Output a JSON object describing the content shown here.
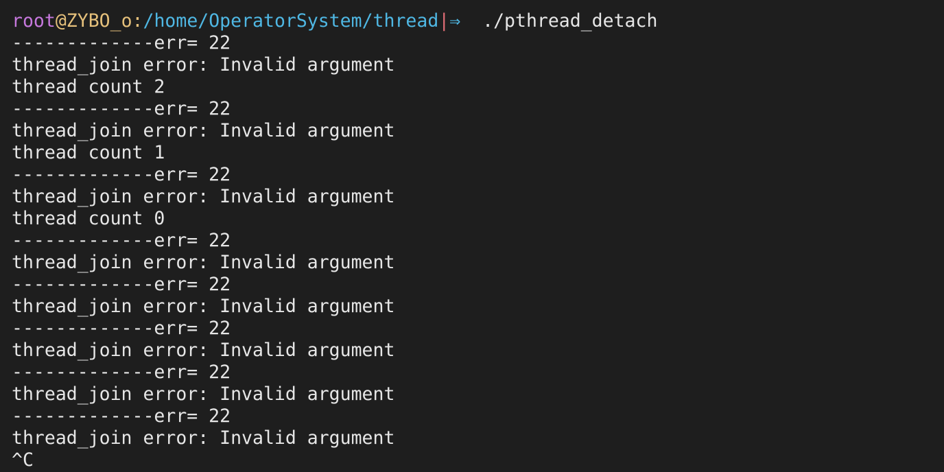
{
  "prompt": {
    "user": "root",
    "at": "@",
    "host": "ZYBO_o",
    "colon": ":",
    "path": "/home/OperatorSystem/thread",
    "separator": "|",
    "arrow": "⇒",
    "command": "  ./pthread_detach"
  },
  "output": [
    "-------------err= 22",
    "thread_join error: Invalid argument",
    "thread count 2",
    "-------------err= 22",
    "thread_join error: Invalid argument",
    "thread count 1",
    "-------------err= 22",
    "thread_join error: Invalid argument",
    "thread count 0",
    "-------------err= 22",
    "thread_join error: Invalid argument",
    "-------------err= 22",
    "thread_join error: Invalid argument",
    "-------------err= 22",
    "thread_join error: Invalid argument",
    "-------------err= 22",
    "thread_join error: Invalid argument",
    "-------------err= 22",
    "thread_join error: Invalid argument",
    "^C"
  ]
}
